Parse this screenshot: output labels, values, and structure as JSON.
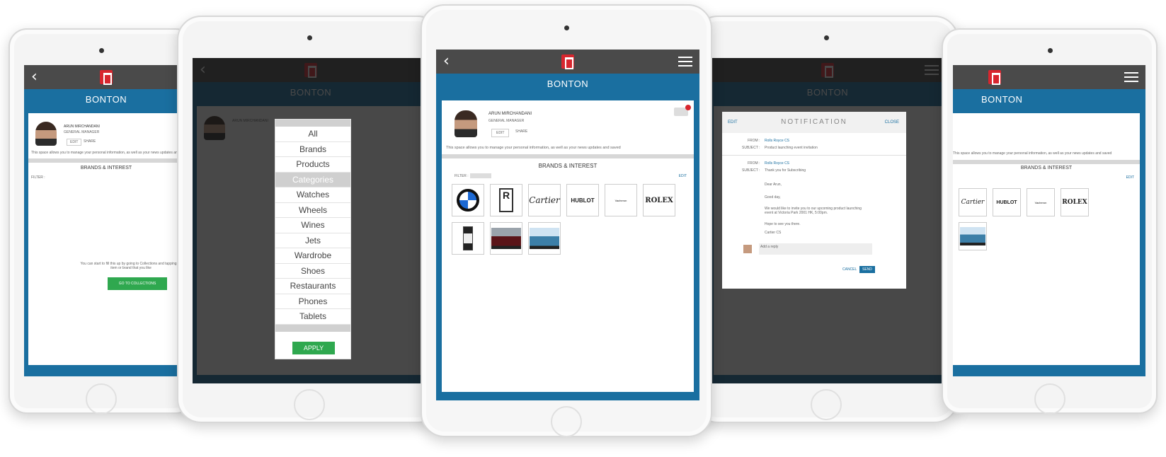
{
  "app": {
    "name": "BONTON"
  },
  "profile": {
    "name": "ARUN MIRCHANDANI",
    "title": "GENERAL MANAGER",
    "edit_label": "EDIT",
    "share_label": "SHARE",
    "description": "This space allows you to manage your personal information, as well as your news updates and saved"
  },
  "brands_section": {
    "heading": "BRANDS & INTEREST",
    "filter_label": "FILTER :",
    "edit_link": "EDIT",
    "brands": [
      "BMW",
      "Rolls-Royce",
      "Cartier",
      "HUBLOT",
      "Vacheron",
      "ROLEX"
    ],
    "items": [
      "Watch",
      "Rolls-Royce Car",
      "Luxury Car"
    ]
  },
  "empty_state": {
    "message": "You can start to fill this up by going to Collections and tapping an item or brand that you like",
    "button": "GO TO COLLECTIONS"
  },
  "categories": {
    "items": [
      "All",
      "Brands",
      "Products",
      "Categories",
      "Watches",
      "Wheels",
      "Wines",
      "Jets",
      "Wardrobe",
      "Shoes",
      "Restaurants",
      "Phones",
      "Tablets"
    ],
    "selected": "Categories",
    "apply_label": "APPLY"
  },
  "notification": {
    "title": "NOTIFICATION",
    "edit_label": "EDIT",
    "close_label": "CLOSE",
    "messages": [
      {
        "from_label": "FROM :",
        "from": "Rolls Royce CS",
        "subject_label": "SUBJECT :",
        "subject": "Product launching event invitation"
      },
      {
        "from_label": "FROM :",
        "from": "Rolls Royce CS",
        "subject_label": "SUBJECT :",
        "subject": "Thank you for Subscribing"
      }
    ],
    "body": [
      "Dear Arun,",
      "Good day,",
      "We would like to invite you to our upcoming product launching event at Victoria Park 2001 HK, 5:00pm.",
      "Hope to see you there.",
      "Cartier CS"
    ],
    "reply_placeholder": "Add a reply",
    "cancel_label": "CANCEL",
    "send_label": "SEND"
  },
  "colors": {
    "accent": "#1a6fa0",
    "topbar": "#4a4a4a",
    "green": "#2fa84f",
    "logo": "#d8262e"
  }
}
